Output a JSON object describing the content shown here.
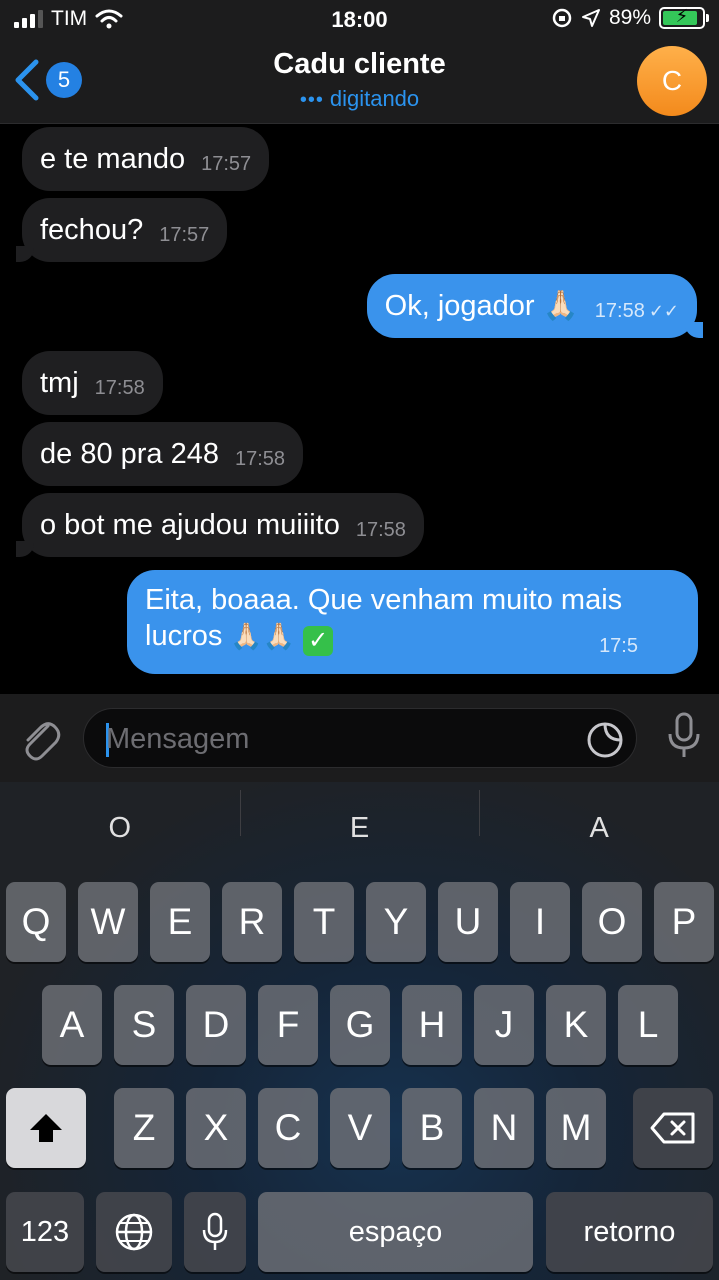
{
  "status_bar": {
    "carrier": "TIM",
    "time": "18:00",
    "battery": "89%"
  },
  "header": {
    "back_count": "5",
    "title": "Cadu cliente",
    "status": "digitando",
    "avatar_letter": "C"
  },
  "messages": [
    {
      "text": "e te mando",
      "time": "17:57",
      "dir": "in"
    },
    {
      "text": "fechou?",
      "time": "17:57",
      "dir": "in"
    },
    {
      "text": "Ok, jogador 🙏🏻",
      "time": "17:58",
      "dir": "out"
    },
    {
      "text": "tmj",
      "time": "17:58",
      "dir": "in"
    },
    {
      "text": "de 80 pra 248",
      "time": "17:58",
      "dir": "in"
    },
    {
      "text": "o bot me ajudou muiiito",
      "time": "17:58",
      "dir": "in"
    },
    {
      "text_line1": "Eita, boaaa. Que venham muito mais",
      "text_line2": "lucros",
      "time": "17:5",
      "dir": "out"
    }
  ],
  "input": {
    "placeholder": "Mensagem"
  },
  "keyboard": {
    "suggestions": [
      "O",
      "E",
      "A"
    ],
    "row1": [
      "Q",
      "W",
      "E",
      "R",
      "T",
      "Y",
      "U",
      "I",
      "O",
      "P"
    ],
    "row2": [
      "A",
      "S",
      "D",
      "F",
      "G",
      "H",
      "J",
      "K",
      "L"
    ],
    "row3": [
      "Z",
      "X",
      "C",
      "V",
      "B",
      "N",
      "M"
    ],
    "numbers_key": "123",
    "space_key": "espaço",
    "return_key": "retorno"
  },
  "colors": {
    "accent": "#2b93ee",
    "outgoing_bubble": "#3a93ec",
    "incoming_bubble": "#1f1f21",
    "avatar": "#f39a2e"
  }
}
